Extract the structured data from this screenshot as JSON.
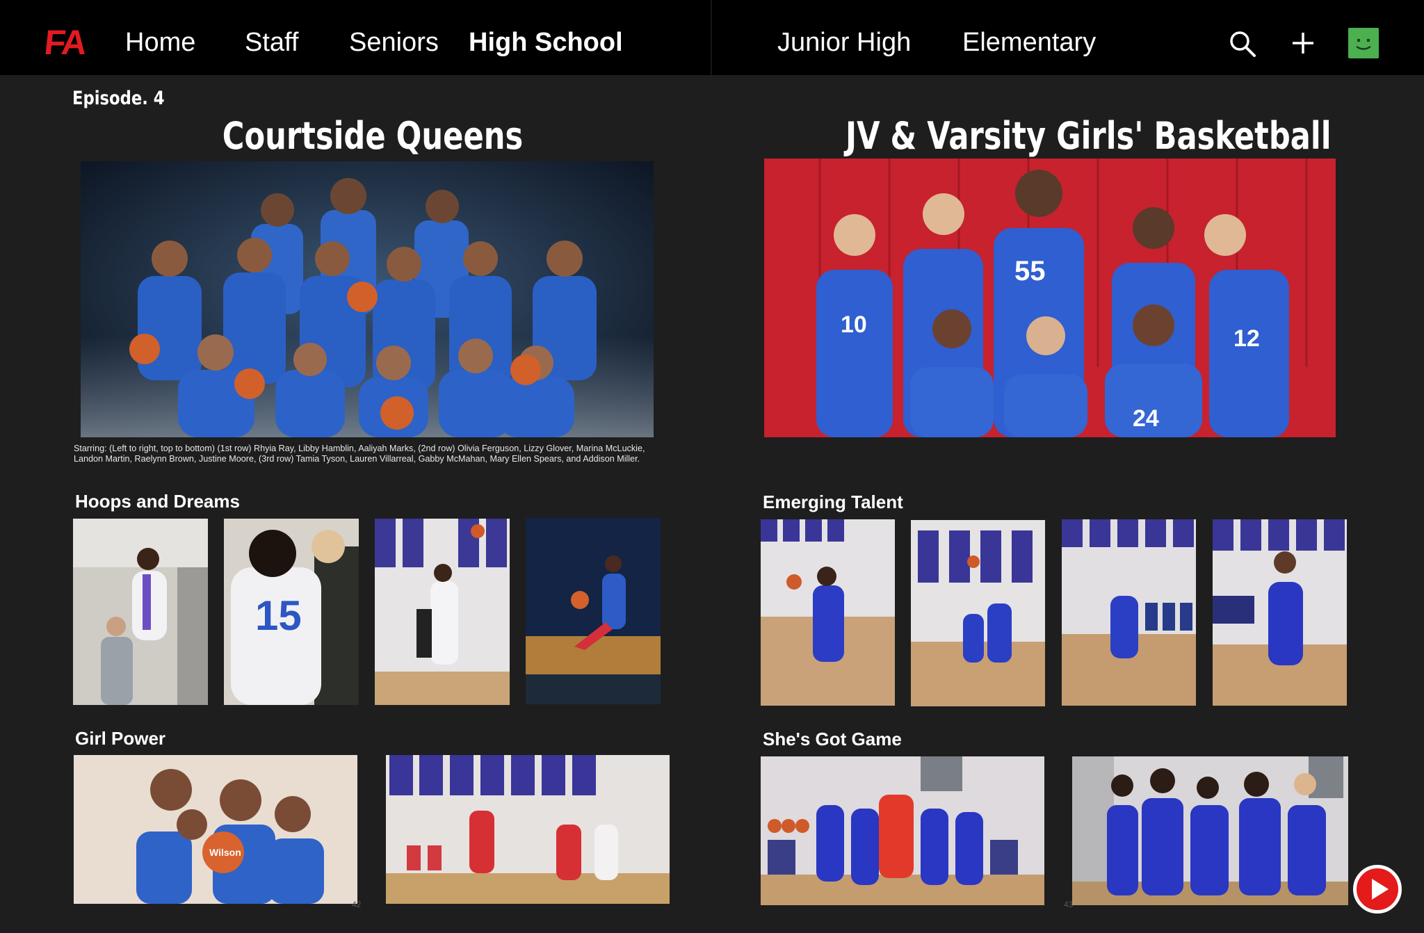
{
  "nav": {
    "logo": "FA",
    "items": [
      "Home",
      "Staff",
      "Seniors",
      "High School",
      "Junior High",
      "Elementary"
    ],
    "active": "High School"
  },
  "colors": {
    "accent": "#e21b22",
    "background": "#1e1e1e",
    "nav_bg": "#000000",
    "avatar": "#4caf50"
  },
  "icons": [
    "search-icon",
    "plus-icon",
    "avatar-icon",
    "play-icon"
  ],
  "left_page": {
    "episode": "Episode. 4",
    "title": "Courtside Queens",
    "caption_line1": "Starring: (Left to right, top to bottom) (1st row) Rhyia Ray, Libby Hamblin, Aaliyah Marks, (2nd row) Olivia Ferguson, Lizzy Glover, Marina McLuckie,",
    "caption_line2": "Landon Martin, Raelynn Brown, Justine Moore, (3rd row) Tamia Tyson, Lauren Villarreal, Gabby McMahan, Mary Ellen Spears, and Addison Miller.",
    "section1": "Hoops and Dreams",
    "section2": "Girl Power",
    "page_number": "42"
  },
  "right_page": {
    "title": "JV & Varsity Girls' Basketball",
    "section1": "Emerging Talent",
    "section2": "She's Got Game",
    "page_number": "43"
  }
}
